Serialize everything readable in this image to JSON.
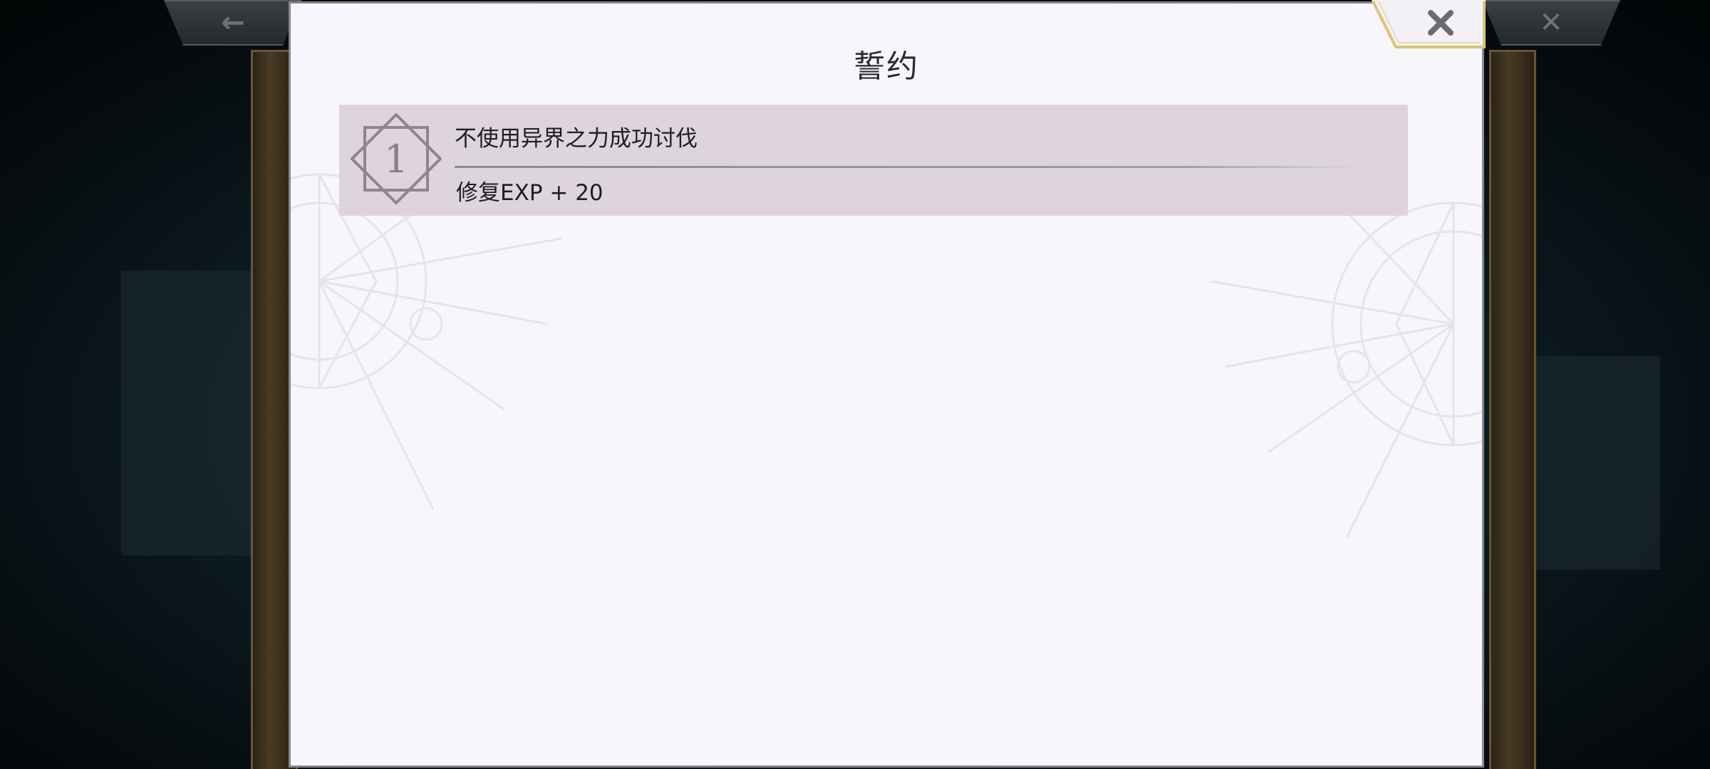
{
  "dialog": {
    "title": "誓约"
  },
  "oaths": [
    {
      "number": "1",
      "condition": "不使用异界之力成功讨伐",
      "reward": "修复EXP + 20"
    }
  ],
  "background": {
    "back_icon": "←",
    "close_icon": "✕"
  },
  "colors": {
    "panel_bg": "#f7f6fa",
    "row_bg": "#ded5dc",
    "close_tab_border": "#d9c47a"
  },
  "icons": {
    "close": "close-icon",
    "back": "back-arrow-icon",
    "badge": "diamond-badge-icon"
  }
}
